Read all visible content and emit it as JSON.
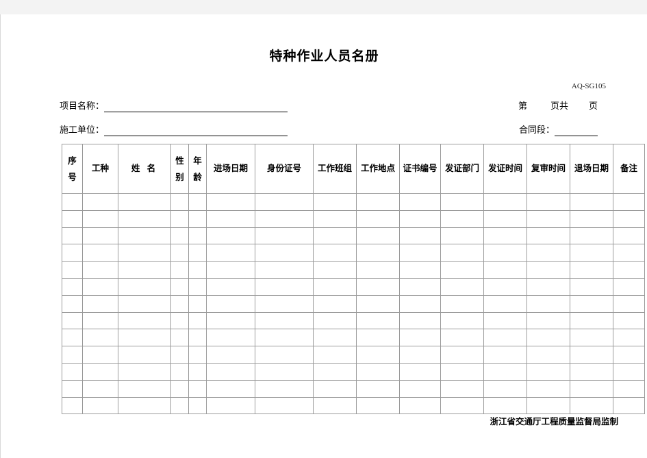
{
  "document": {
    "title": "特种作业人员名册",
    "form_code": "AQ-SG105",
    "footer_note": "浙江省交通厅工程质量监督局监制"
  },
  "meta": {
    "project_label": "项目名称：",
    "project_value": "",
    "unit_label": "施工单位：",
    "unit_value": "",
    "page_prefix": "第",
    "page_middle": "页共",
    "page_suffix": "页",
    "contract_label": "合同段：",
    "contract_value": ""
  },
  "table": {
    "columns": [
      {
        "label": "序号",
        "orientation": "vertical",
        "lines": [
          "序",
          "号"
        ]
      },
      {
        "label": "工种",
        "orientation": "horizontal"
      },
      {
        "label": "姓 名",
        "orientation": "horizontal"
      },
      {
        "label": "性别",
        "orientation": "vertical",
        "lines": [
          "性",
          "别"
        ]
      },
      {
        "label": "年龄",
        "orientation": "vertical",
        "lines": [
          "年",
          "龄"
        ]
      },
      {
        "label": "进场日期",
        "orientation": "horizontal"
      },
      {
        "label": "身份证号",
        "orientation": "horizontal"
      },
      {
        "label": "工作班组",
        "orientation": "horizontal"
      },
      {
        "label": "工作地点",
        "orientation": "horizontal"
      },
      {
        "label": "证书编号",
        "orientation": "horizontal"
      },
      {
        "label": "发证部门",
        "orientation": "horizontal"
      },
      {
        "label": "发证时间",
        "orientation": "horizontal"
      },
      {
        "label": "复审时间",
        "orientation": "horizontal"
      },
      {
        "label": "退场日期",
        "orientation": "horizontal"
      },
      {
        "label": "备注",
        "orientation": "horizontal"
      }
    ],
    "row_count": 13,
    "rows": [
      [
        "",
        "",
        "",
        "",
        "",
        "",
        "",
        "",
        "",
        "",
        "",
        "",
        "",
        "",
        ""
      ],
      [
        "",
        "",
        "",
        "",
        "",
        "",
        "",
        "",
        "",
        "",
        "",
        "",
        "",
        "",
        ""
      ],
      [
        "",
        "",
        "",
        "",
        "",
        "",
        "",
        "",
        "",
        "",
        "",
        "",
        "",
        "",
        ""
      ],
      [
        "",
        "",
        "",
        "",
        "",
        "",
        "",
        "",
        "",
        "",
        "",
        "",
        "",
        "",
        ""
      ],
      [
        "",
        "",
        "",
        "",
        "",
        "",
        "",
        "",
        "",
        "",
        "",
        "",
        "",
        "",
        ""
      ],
      [
        "",
        "",
        "",
        "",
        "",
        "",
        "",
        "",
        "",
        "",
        "",
        "",
        "",
        "",
        ""
      ],
      [
        "",
        "",
        "",
        "",
        "",
        "",
        "",
        "",
        "",
        "",
        "",
        "",
        "",
        "",
        ""
      ],
      [
        "",
        "",
        "",
        "",
        "",
        "",
        "",
        "",
        "",
        "",
        "",
        "",
        "",
        "",
        ""
      ],
      [
        "",
        "",
        "",
        "",
        "",
        "",
        "",
        "",
        "",
        "",
        "",
        "",
        "",
        "",
        ""
      ],
      [
        "",
        "",
        "",
        "",
        "",
        "",
        "",
        "",
        "",
        "",
        "",
        "",
        "",
        "",
        ""
      ],
      [
        "",
        "",
        "",
        "",
        "",
        "",
        "",
        "",
        "",
        "",
        "",
        "",
        "",
        "",
        ""
      ],
      [
        "",
        "",
        "",
        "",
        "",
        "",
        "",
        "",
        "",
        "",
        "",
        "",
        "",
        "",
        ""
      ],
      [
        "",
        "",
        "",
        "",
        "",
        "",
        "",
        "",
        "",
        "",
        "",
        "",
        "",
        "",
        ""
      ]
    ]
  },
  "colors": {
    "page_background": "#ffffff",
    "canvas_background": "#f3f3f3",
    "grid_line": "#9a9a9a",
    "text": "#000000"
  }
}
